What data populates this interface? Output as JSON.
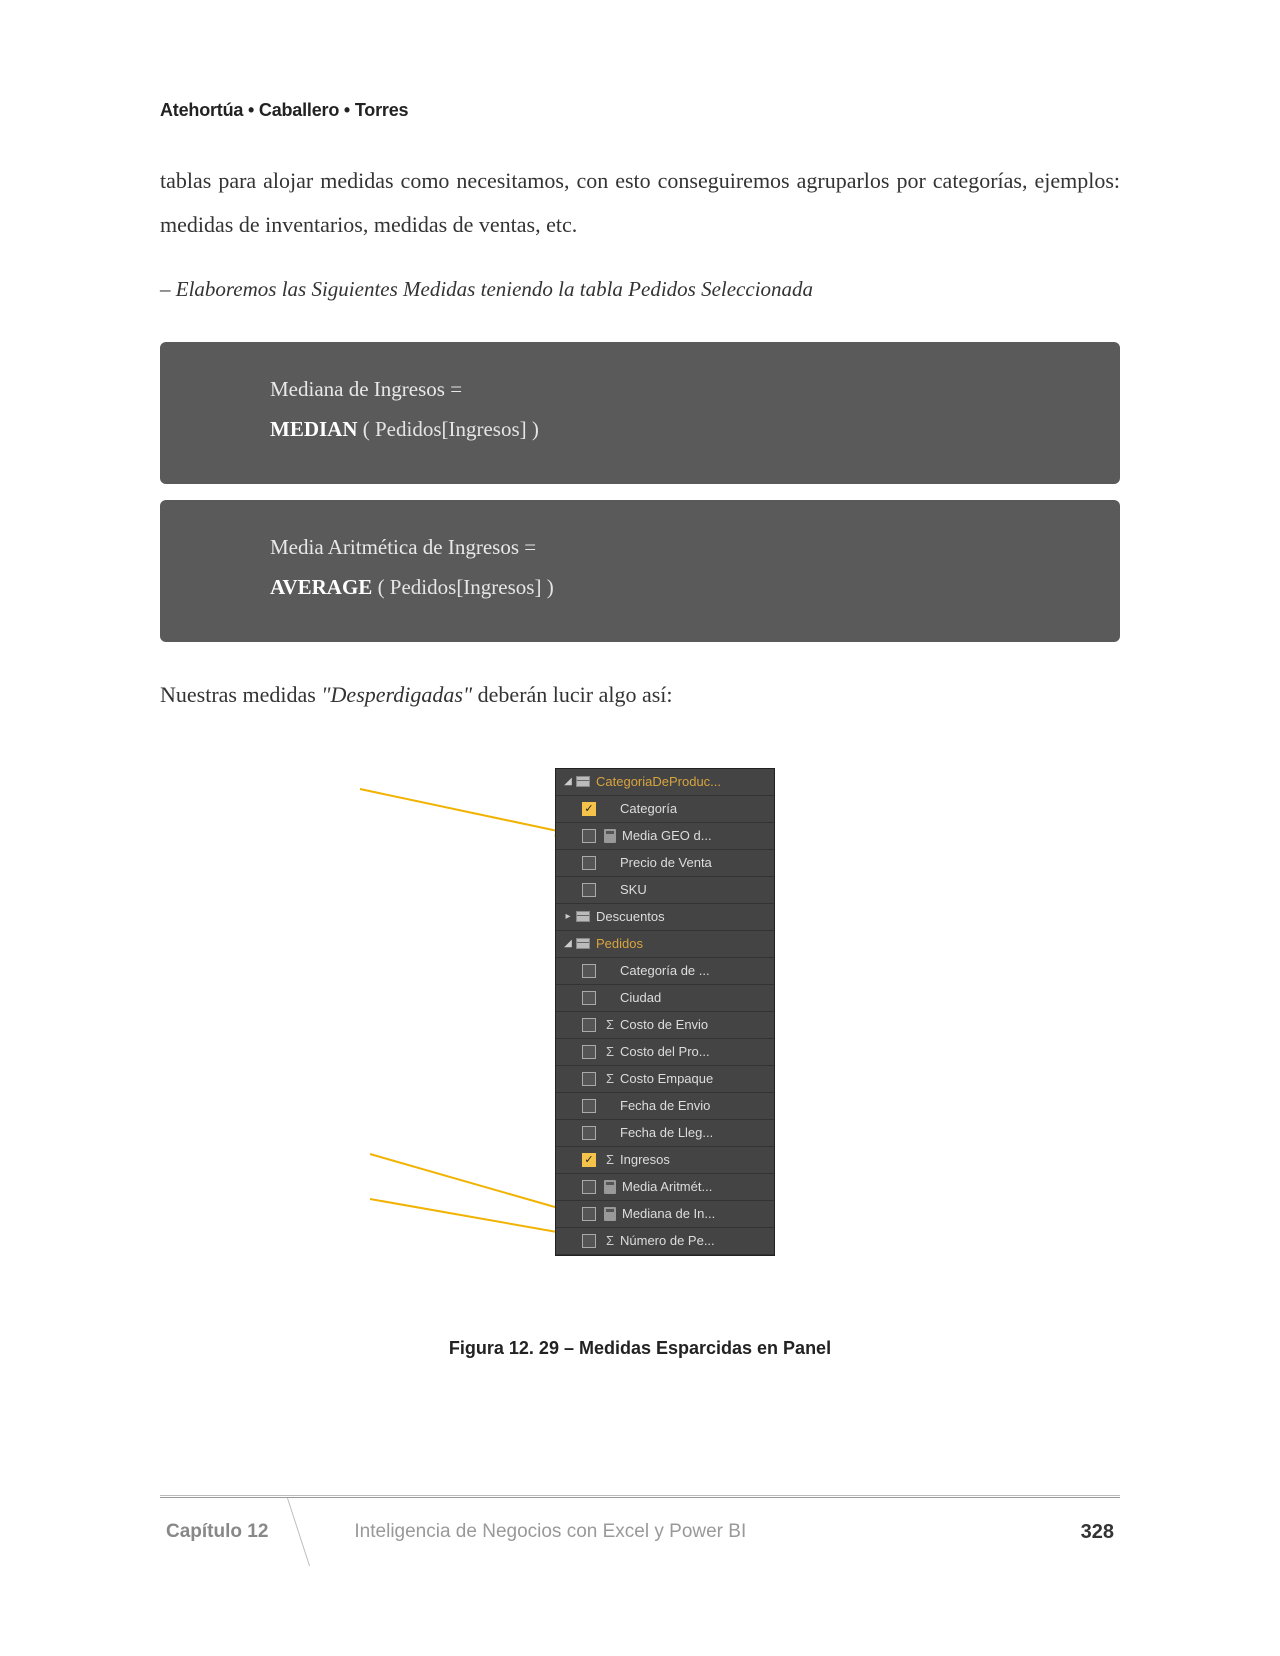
{
  "header": {
    "authors": "Atehortúa • Caballero • Torres"
  },
  "body": {
    "intro": "tablas para alojar medidas como necesitamos, con esto conseguiremos agruparlos por categorías, ejemplos: medidas de inventarios, medidas de ventas, etc.",
    "instruction_dash": "–",
    "instruction": "Elaboremos las Siguientes Medidas teniendo la tabla Pedidos Seleccionada",
    "post_prefix": "Nuestras medidas ",
    "post_quote": "\"Desperdigadas\"",
    "post_suffix": " deberán lucir algo así:"
  },
  "code1": {
    "title": "Mediana de Ingresos =",
    "fn": "MEDIAN",
    "args": " ( Pedidos[Ingresos] )"
  },
  "code2": {
    "title": "Media Aritmética de Ingresos =",
    "fn": "AVERAGE",
    "args": " ( Pedidos[Ingresos] )"
  },
  "panel": {
    "tables": {
      "t0": {
        "name": "CategoriaDeProduc...",
        "expanded": true
      },
      "t1": {
        "name": "Descuentos",
        "expanded": false
      },
      "t2": {
        "name": "Pedidos",
        "expanded": true
      }
    },
    "t0_fields": {
      "f0": {
        "label": "Categoría",
        "checked": true,
        "sigma": false,
        "calc": false
      },
      "f1": {
        "label": "Media GEO d...",
        "checked": false,
        "sigma": false,
        "calc": true
      },
      "f2": {
        "label": "Precio de Venta",
        "checked": false,
        "sigma": false,
        "calc": false
      },
      "f3": {
        "label": "SKU",
        "checked": false,
        "sigma": false,
        "calc": false
      }
    },
    "t2_fields": {
      "f0": {
        "label": "Categoría de ...",
        "checked": false,
        "sigma": false,
        "calc": false
      },
      "f1": {
        "label": "Ciudad",
        "checked": false,
        "sigma": false,
        "calc": false
      },
      "f2": {
        "label": "Costo de Envio",
        "checked": false,
        "sigma": true,
        "calc": false
      },
      "f3": {
        "label": "Costo del Pro...",
        "checked": false,
        "sigma": true,
        "calc": false
      },
      "f4": {
        "label": "Costo Empaque",
        "checked": false,
        "sigma": true,
        "calc": false
      },
      "f5": {
        "label": "Fecha de Envio",
        "checked": false,
        "sigma": false,
        "calc": false
      },
      "f6": {
        "label": "Fecha de Lleg...",
        "checked": false,
        "sigma": false,
        "calc": false
      },
      "f7": {
        "label": "Ingresos",
        "checked": true,
        "sigma": true,
        "calc": false
      },
      "f8": {
        "label": "Media Aritmét...",
        "checked": false,
        "sigma": false,
        "calc": true
      },
      "f9": {
        "label": "Mediana de In...",
        "checked": false,
        "sigma": false,
        "calc": true
      },
      "f10": {
        "label": "Número de Pe...",
        "checked": false,
        "sigma": true,
        "calc": false
      }
    }
  },
  "caption": "Figura 12. 29 – Medidas Esparcidas en Panel",
  "footer": {
    "chapter": "Capítulo 12",
    "title": "Inteligencia de Negocios con Excel y Power BI",
    "page": "328"
  },
  "glyphs": {
    "down_tri": "◢",
    "right_tri": "▸",
    "check": "✓",
    "sigma": "Σ"
  }
}
